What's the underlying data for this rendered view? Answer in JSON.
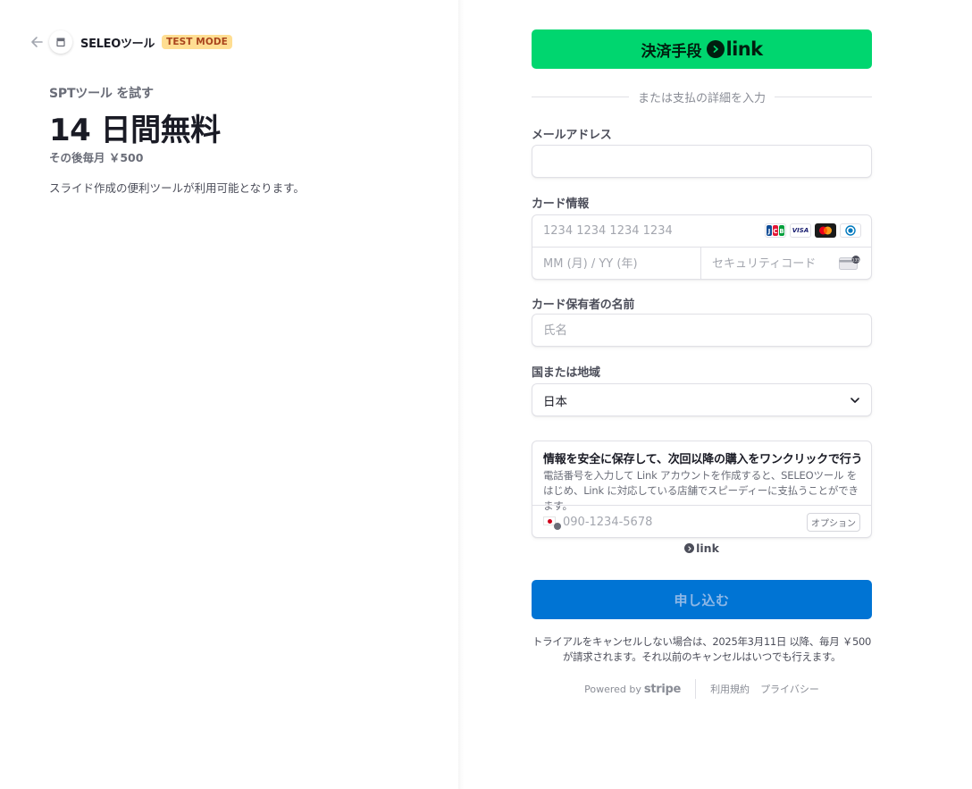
{
  "header": {
    "business_name": "SELEOツール",
    "test_mode_badge": "TEST MODE"
  },
  "summary": {
    "product_name": "SPTツール を試す",
    "trial_title": "14 日間無料",
    "after_price": "その後毎月 ￥500",
    "description": "スライド作成の便利ツールが利用可能となります。"
  },
  "link_button": {
    "label": "決済手段",
    "brand": "link"
  },
  "divider_text": "または支払の詳細を入力",
  "email": {
    "label": "メールアドレス",
    "value": "",
    "placeholder": ""
  },
  "card": {
    "label": "カード情報",
    "number_placeholder": "1234 1234 1234 1234",
    "expiry_placeholder": "MM (月) / YY (年)",
    "cvc_placeholder": "セキュリティコード",
    "cvc_icon_text": "135",
    "brands": [
      "jcb-icon",
      "visa-icon",
      "mastercard-icon",
      "diners-icon"
    ],
    "brand_labels": {
      "jcb": "JCB",
      "visa": "VISA"
    }
  },
  "cardholder": {
    "label": "カード保有者の名前",
    "placeholder": "氏名"
  },
  "country": {
    "label": "国または地域",
    "selected": "日本"
  },
  "save_info": {
    "heading": "情報を安全に保存して、次回以降の購入をワンクリックで行う",
    "body": "電話番号を入力して Link アカウントを作成すると、SELEOツール をはじめ、Link に対応している店舗でスピーディーに支払うことができます。",
    "phone_placeholder": "090-1234-5678",
    "optional_label": "オプション"
  },
  "link_mark": "link",
  "submit": {
    "label": "申し込む"
  },
  "terms": {
    "line1": "トライアルをキャンセルしない場合は、2025年3月11日 以降、毎月 ￥500",
    "line2": "が請求されます。それ以前のキャンセルはいつでも行えます。"
  },
  "footer": {
    "powered_by": "Powered by",
    "stripe": "stripe",
    "terms_link": "利用規約",
    "privacy_link": "プライバシー"
  },
  "colors": {
    "link_green": "#00d66f",
    "submit_blue": "#0074d4",
    "test_badge_bg": "#ffde92",
    "test_badge_text": "#a9441c"
  }
}
